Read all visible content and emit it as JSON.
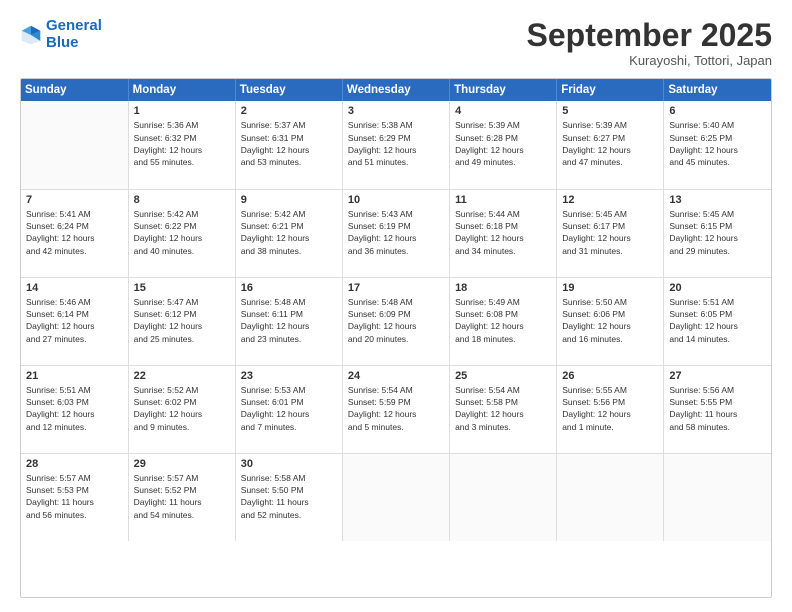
{
  "header": {
    "logo_line1": "General",
    "logo_line2": "Blue",
    "month": "September 2025",
    "location": "Kurayoshi, Tottori, Japan"
  },
  "weekdays": [
    "Sunday",
    "Monday",
    "Tuesday",
    "Wednesday",
    "Thursday",
    "Friday",
    "Saturday"
  ],
  "weeks": [
    [
      {
        "num": "",
        "info": ""
      },
      {
        "num": "1",
        "info": "Sunrise: 5:36 AM\nSunset: 6:32 PM\nDaylight: 12 hours\nand 55 minutes."
      },
      {
        "num": "2",
        "info": "Sunrise: 5:37 AM\nSunset: 6:31 PM\nDaylight: 12 hours\nand 53 minutes."
      },
      {
        "num": "3",
        "info": "Sunrise: 5:38 AM\nSunset: 6:29 PM\nDaylight: 12 hours\nand 51 minutes."
      },
      {
        "num": "4",
        "info": "Sunrise: 5:39 AM\nSunset: 6:28 PM\nDaylight: 12 hours\nand 49 minutes."
      },
      {
        "num": "5",
        "info": "Sunrise: 5:39 AM\nSunset: 6:27 PM\nDaylight: 12 hours\nand 47 minutes."
      },
      {
        "num": "6",
        "info": "Sunrise: 5:40 AM\nSunset: 6:25 PM\nDaylight: 12 hours\nand 45 minutes."
      }
    ],
    [
      {
        "num": "7",
        "info": "Sunrise: 5:41 AM\nSunset: 6:24 PM\nDaylight: 12 hours\nand 42 minutes."
      },
      {
        "num": "8",
        "info": "Sunrise: 5:42 AM\nSunset: 6:22 PM\nDaylight: 12 hours\nand 40 minutes."
      },
      {
        "num": "9",
        "info": "Sunrise: 5:42 AM\nSunset: 6:21 PM\nDaylight: 12 hours\nand 38 minutes."
      },
      {
        "num": "10",
        "info": "Sunrise: 5:43 AM\nSunset: 6:19 PM\nDaylight: 12 hours\nand 36 minutes."
      },
      {
        "num": "11",
        "info": "Sunrise: 5:44 AM\nSunset: 6:18 PM\nDaylight: 12 hours\nand 34 minutes."
      },
      {
        "num": "12",
        "info": "Sunrise: 5:45 AM\nSunset: 6:17 PM\nDaylight: 12 hours\nand 31 minutes."
      },
      {
        "num": "13",
        "info": "Sunrise: 5:45 AM\nSunset: 6:15 PM\nDaylight: 12 hours\nand 29 minutes."
      }
    ],
    [
      {
        "num": "14",
        "info": "Sunrise: 5:46 AM\nSunset: 6:14 PM\nDaylight: 12 hours\nand 27 minutes."
      },
      {
        "num": "15",
        "info": "Sunrise: 5:47 AM\nSunset: 6:12 PM\nDaylight: 12 hours\nand 25 minutes."
      },
      {
        "num": "16",
        "info": "Sunrise: 5:48 AM\nSunset: 6:11 PM\nDaylight: 12 hours\nand 23 minutes."
      },
      {
        "num": "17",
        "info": "Sunrise: 5:48 AM\nSunset: 6:09 PM\nDaylight: 12 hours\nand 20 minutes."
      },
      {
        "num": "18",
        "info": "Sunrise: 5:49 AM\nSunset: 6:08 PM\nDaylight: 12 hours\nand 18 minutes."
      },
      {
        "num": "19",
        "info": "Sunrise: 5:50 AM\nSunset: 6:06 PM\nDaylight: 12 hours\nand 16 minutes."
      },
      {
        "num": "20",
        "info": "Sunrise: 5:51 AM\nSunset: 6:05 PM\nDaylight: 12 hours\nand 14 minutes."
      }
    ],
    [
      {
        "num": "21",
        "info": "Sunrise: 5:51 AM\nSunset: 6:03 PM\nDaylight: 12 hours\nand 12 minutes."
      },
      {
        "num": "22",
        "info": "Sunrise: 5:52 AM\nSunset: 6:02 PM\nDaylight: 12 hours\nand 9 minutes."
      },
      {
        "num": "23",
        "info": "Sunrise: 5:53 AM\nSunset: 6:01 PM\nDaylight: 12 hours\nand 7 minutes."
      },
      {
        "num": "24",
        "info": "Sunrise: 5:54 AM\nSunset: 5:59 PM\nDaylight: 12 hours\nand 5 minutes."
      },
      {
        "num": "25",
        "info": "Sunrise: 5:54 AM\nSunset: 5:58 PM\nDaylight: 12 hours\nand 3 minutes."
      },
      {
        "num": "26",
        "info": "Sunrise: 5:55 AM\nSunset: 5:56 PM\nDaylight: 12 hours\nand 1 minute."
      },
      {
        "num": "27",
        "info": "Sunrise: 5:56 AM\nSunset: 5:55 PM\nDaylight: 11 hours\nand 58 minutes."
      }
    ],
    [
      {
        "num": "28",
        "info": "Sunrise: 5:57 AM\nSunset: 5:53 PM\nDaylight: 11 hours\nand 56 minutes."
      },
      {
        "num": "29",
        "info": "Sunrise: 5:57 AM\nSunset: 5:52 PM\nDaylight: 11 hours\nand 54 minutes."
      },
      {
        "num": "30",
        "info": "Sunrise: 5:58 AM\nSunset: 5:50 PM\nDaylight: 11 hours\nand 52 minutes."
      },
      {
        "num": "",
        "info": ""
      },
      {
        "num": "",
        "info": ""
      },
      {
        "num": "",
        "info": ""
      },
      {
        "num": "",
        "info": ""
      }
    ]
  ]
}
